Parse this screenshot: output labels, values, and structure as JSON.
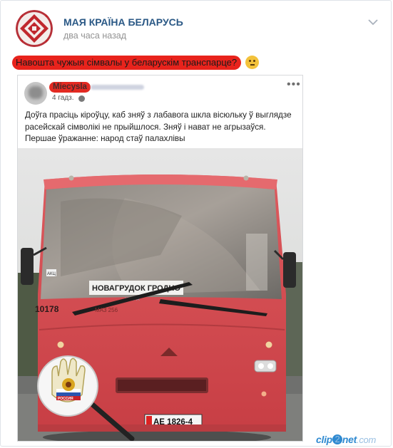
{
  "group": {
    "name": "МАЯ КРАЇНА БЕЛАРУСЬ",
    "time": "два часа назад"
  },
  "post": {
    "caption": "Навошта чужыя сімвалы у беларускім транспарце?"
  },
  "repost": {
    "author": "Miecysla",
    "time": "4 гадз.",
    "more": "•••",
    "text": [
      "Доўга прасіць кіроўцу, каб зняў з лабавога шкла вісюльку ў выглядзе",
      "расейскай сімволікі не прыйшлося. Зняў і нават не агрызаўся.",
      "Першае ўражанне: народ стаў палахлівы"
    ]
  },
  "bus": {
    "route_sign": "НОВАГРУДОК ГРОДНО",
    "route_sub": "ШОРА",
    "fleet_number": "10178",
    "model": "MA3 256",
    "plate": "AE 1826-4",
    "windshield_sticker": "АКЦ"
  },
  "pendant": {
    "flag_text": "РОССИЯ"
  },
  "watermark": {
    "brand_start": "clip",
    "brand_digit": "2",
    "brand_end": "net",
    "domain": ".com"
  },
  "colors": {
    "bus_red": "#d94a4f",
    "highlight_red": "#e8231c",
    "vk_blue": "#2a5885"
  }
}
